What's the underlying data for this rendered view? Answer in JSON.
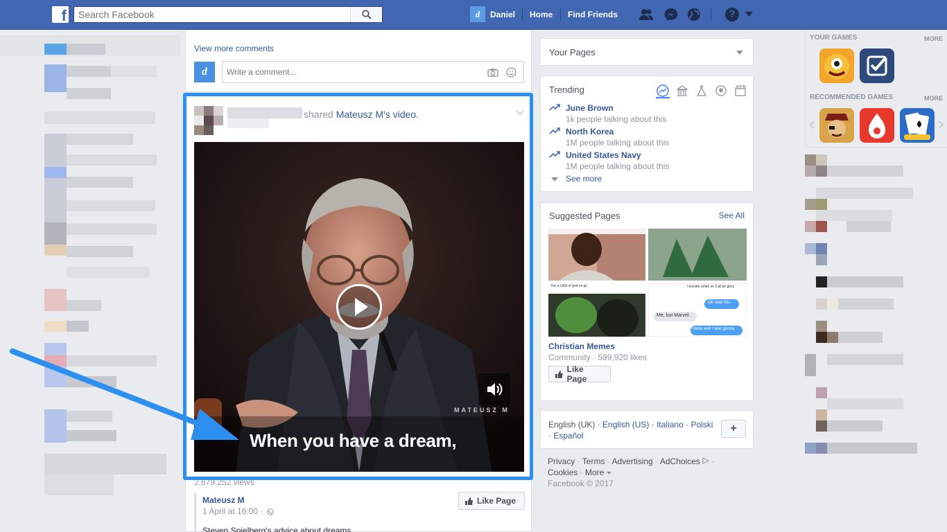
{
  "topbar": {
    "search_placeholder": "Search Facebook",
    "profile_initial": "d",
    "profile_name": "Daniel",
    "home": "Home",
    "find_friends": "Find Friends",
    "help": "?"
  },
  "feed": {
    "view_more_comments": "View more comments",
    "comment_avatar": "d",
    "comment_placeholder": "Write a comment...",
    "post": {
      "shared_text": "shared",
      "shared_author": "Mateusz M",
      "shared_suffix": "'s video.",
      "video_watermark": "MATEUSZ M",
      "video_caption": "When you have a dream,",
      "views": "2,679,252 views",
      "page_name": "Mateusz M",
      "timestamp": "1 April at 16:00 · ",
      "like_page": "Like Page",
      "description": "Steven Spielberg's advice about dreams"
    }
  },
  "right": {
    "your_pages": "Your Pages",
    "trending": {
      "title": "Trending",
      "items": [
        {
          "topic": "June Brown",
          "sub": "1k people talking about this"
        },
        {
          "topic": "North Korea",
          "sub": "1M people talking about this"
        },
        {
          "topic": "United States Navy",
          "sub": "1M people talking about this"
        }
      ],
      "see_more": "See more"
    },
    "suggested": {
      "title": "Suggested Pages",
      "see_all": "See All",
      "meme_texts": [
        "You a child of god so go",
        "i wonder when ne ll all be glory",
        "Ok read this",
        "Me, but Marvel.",
        "Haha well I was gonna"
      ],
      "page_name": "Christian Memes",
      "page_meta": "Community · 599,920 likes",
      "like_page": "Like Page"
    },
    "languages": {
      "current": "English (UK)",
      "others": [
        "English (US)",
        "Italiano",
        "Polski",
        "Español"
      ],
      "add": "+"
    },
    "footer": {
      "links": [
        "Privacy",
        "Terms",
        "Advertising",
        "AdChoices",
        "Cookies",
        "More"
      ],
      "copyright": "Facebook © 2017"
    }
  },
  "games": {
    "your_games": "YOUR GAMES",
    "more1": "MORE",
    "recommended": "RECOMMENDED GAMES",
    "more2": "MORE"
  },
  "colors": {
    "brand": "#4267b2",
    "highlight": "#2d8ff0",
    "link": "#365899"
  }
}
